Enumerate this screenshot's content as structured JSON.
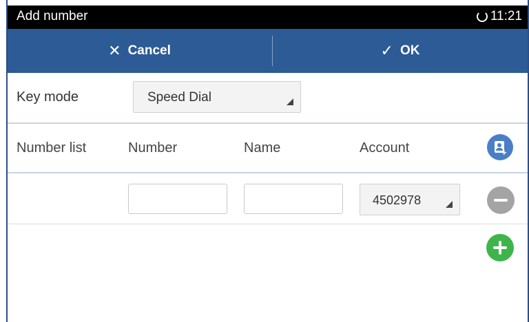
{
  "status_bar": {
    "title": "Add number",
    "time": "11:21",
    "sync_icon": "sync-icon"
  },
  "action_bar": {
    "cancel_label": "Cancel",
    "cancel_icon": "close-icon",
    "ok_label": "OK",
    "ok_icon": "check-icon"
  },
  "key_mode": {
    "label": "Key mode",
    "selected": "Speed Dial"
  },
  "number_list": {
    "headers": {
      "number_list": "Number list",
      "number": "Number",
      "name": "Name",
      "account": "Account"
    },
    "contacts_icon": "add-contact-icon",
    "rows": [
      {
        "number": "",
        "name": "",
        "account": "4502978"
      }
    ],
    "remove_icon": "remove-icon",
    "add_icon": "add-icon"
  },
  "colors": {
    "action_bar": "#2d5b96",
    "status_bar": "#000000",
    "contacts_button": "#4a7fc8",
    "remove_button": "#a4a4a4",
    "add_button": "#3fb44a"
  }
}
